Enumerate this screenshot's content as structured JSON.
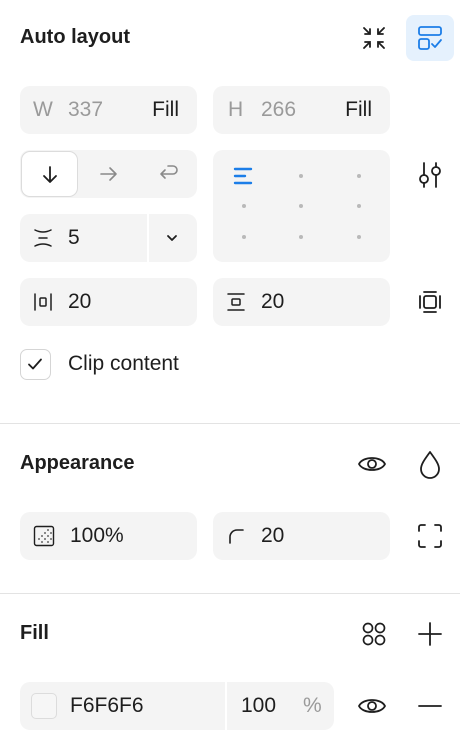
{
  "autolayout": {
    "title": "Auto layout",
    "width_prefix": "W",
    "width_value": "337",
    "width_mode": "Fill",
    "height_prefix": "H",
    "height_value": "266",
    "height_mode": "Fill",
    "gap_value": "5",
    "padding_horizontal": "20",
    "padding_vertical": "20",
    "clip_label": "Clip content",
    "clip_checked": true,
    "direction_selected": "vertical"
  },
  "appearance": {
    "title": "Appearance",
    "opacity": "100%",
    "radius": "20"
  },
  "fill": {
    "title": "Fill",
    "color_hex": "F6F6F6",
    "opacity": "100",
    "percent": "%",
    "swatch_color": "#F6F6F6"
  },
  "colors": {
    "accent": "#1c7ee8",
    "accent_bg": "#e5f1fd",
    "field_bg": "#f4f4f4"
  }
}
